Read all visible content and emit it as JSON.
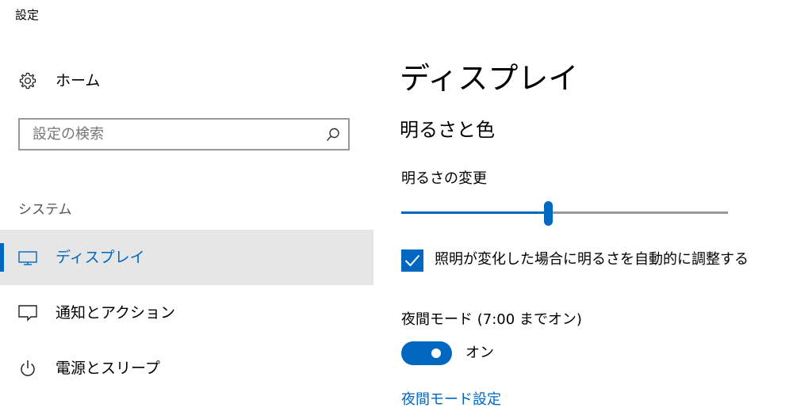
{
  "app": {
    "title": "設定"
  },
  "sidebar": {
    "home": {
      "label": "ホーム",
      "icon": "gear-icon"
    },
    "search": {
      "placeholder": "設定の検索",
      "value": "",
      "icon": "search-icon"
    },
    "section_label": "システム",
    "items": [
      {
        "label": "ディスプレイ",
        "icon": "monitor-icon",
        "selected": true
      },
      {
        "label": "通知とアクション",
        "icon": "notification-icon",
        "selected": false
      },
      {
        "label": "電源とスリープ",
        "icon": "power-icon",
        "selected": false
      }
    ]
  },
  "main": {
    "title": "ディスプレイ",
    "section_heading": "明るさと色",
    "brightness": {
      "label": "明るさの変更",
      "value_fraction": 0.45
    },
    "auto_brightness": {
      "label": "照明が変化した場合に明るさを自動的に調整する",
      "checked": true
    },
    "night_light": {
      "label": "夜間モード (7:00 までオン)",
      "toggle_on": true,
      "toggle_text": "オン"
    },
    "night_light_settings_link": "夜間モード設定"
  },
  "colors": {
    "accent": "#0067c0",
    "selected_bg": "#e6e6e6",
    "border": "#999999",
    "muted_text": "#555555"
  }
}
